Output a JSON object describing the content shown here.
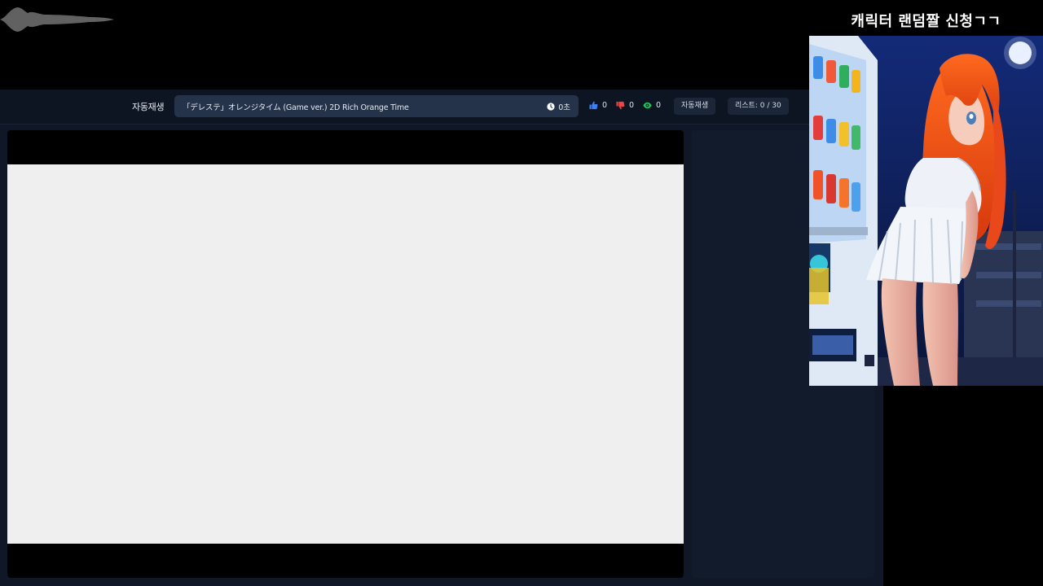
{
  "overlay": {
    "caption": "캐릭터 랜덤짤 신청ㄱㄱ"
  },
  "player": {
    "autoplay_label": "자동재생",
    "track_title": "「デレステ」オレンジタイム (Game ver.) 2D Rich Orange Time",
    "elapsed": "0초",
    "likes": "0",
    "dislikes": "0",
    "views": "0",
    "autoplay_button": "자동재생",
    "list_count": "리스트: 0 / 30"
  },
  "icons": {
    "clock": "clock-icon",
    "like": "thumbs-up-icon",
    "dislike": "thumbs-down-icon",
    "views": "eye-icon"
  },
  "colors": {
    "like": "#3b82f6",
    "dislike": "#ef4444",
    "views": "#22c55e"
  }
}
